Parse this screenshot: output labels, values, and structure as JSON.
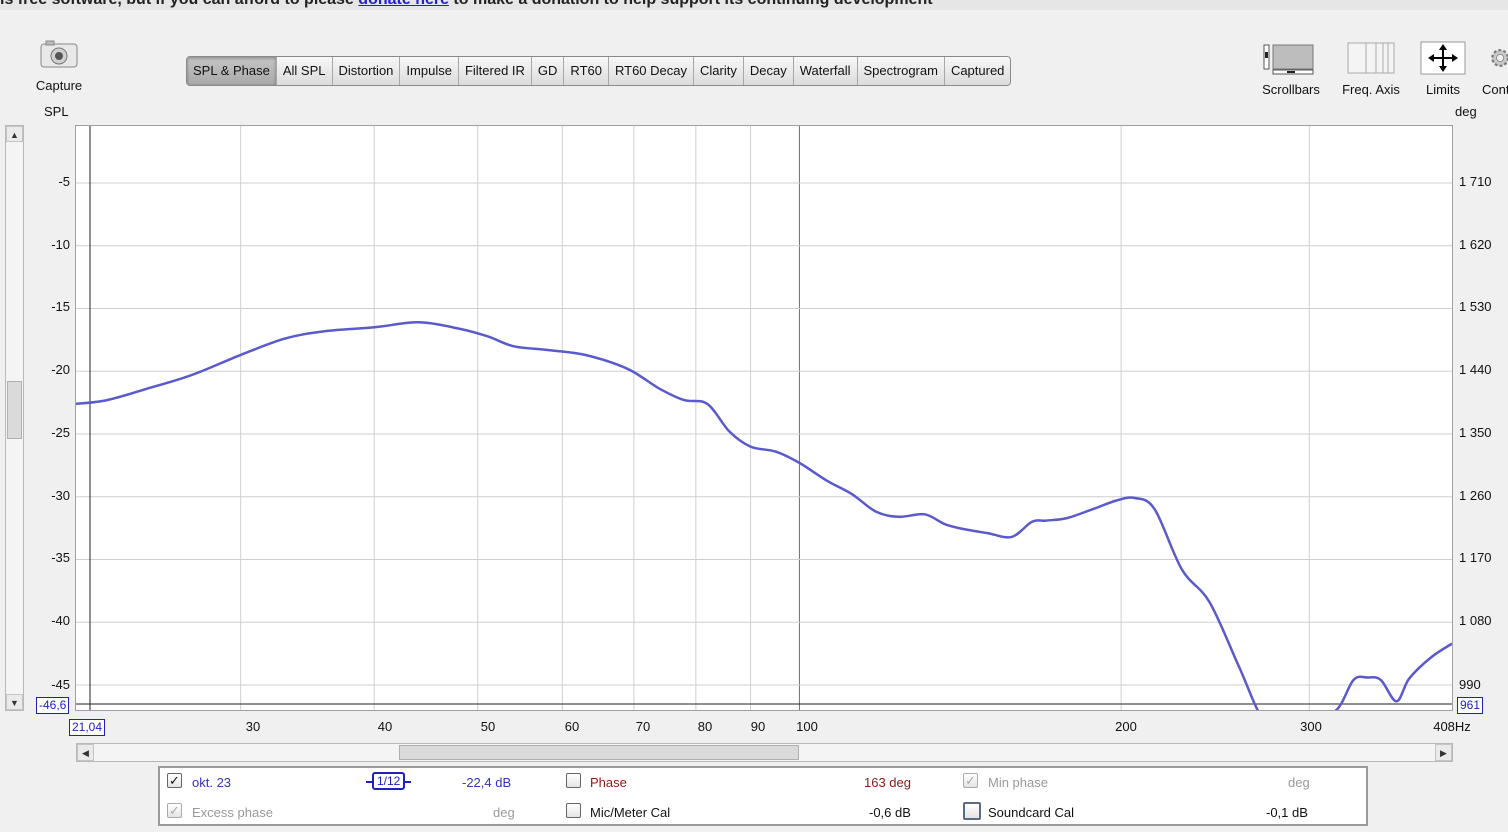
{
  "banner": {
    "text_before": "is free software, but if you can afford to please ",
    "link": "donate here",
    "text_after": " to make a donation to help support its continuing development"
  },
  "capture": {
    "label": "Capture",
    "icon": "camera-icon"
  },
  "tabs": [
    {
      "label": "SPL & Phase",
      "active": true
    },
    {
      "label": "All SPL"
    },
    {
      "label": "Distortion"
    },
    {
      "label": "Impulse"
    },
    {
      "label": "Filtered IR"
    },
    {
      "label": "GD"
    },
    {
      "label": "RT60"
    },
    {
      "label": "RT60 Decay"
    },
    {
      "label": "Clarity"
    },
    {
      "label": "Decay"
    },
    {
      "label": "Waterfall"
    },
    {
      "label": "Spectrogram"
    },
    {
      "label": "Captured"
    }
  ],
  "toolbar": {
    "scrollbars": "Scrollbars",
    "freq_axis": "Freq. Axis",
    "limits": "Limits",
    "controls": "Cont"
  },
  "graph": {
    "left_axis_title": "SPL",
    "right_axis_title": "deg",
    "left_ticks": [
      "-5",
      "-10",
      "-15",
      "-20",
      "-25",
      "-30",
      "-35",
      "-40",
      "-45"
    ],
    "right_ticks": [
      "1 710",
      "1 620",
      "1 530",
      "1 440",
      "1 350",
      "1 260",
      "1 170",
      "1 080",
      "990"
    ],
    "left_bottom_value": "-46,6",
    "right_bottom_value": "961",
    "x_ticks": [
      "30",
      "40",
      "50",
      "60",
      "70",
      "80",
      "90",
      "100",
      "200",
      "300"
    ],
    "x_start_value": "21,04",
    "x_end_label": "408Hz",
    "curve_color": "#5a5acc"
  },
  "chart_data": {
    "type": "line",
    "title": "",
    "xlabel": "Hz",
    "ylabel": "SPL",
    "x_scale": "log",
    "xlim": [
      21.04,
      408
    ],
    "ylim": [
      -46.6,
      0
    ],
    "y2_label": "deg",
    "y2_lim": [
      961,
      1800
    ],
    "grid": true,
    "series": [
      {
        "name": "okt. 23",
        "color": "#5a5acc",
        "x": [
          21.04,
          22.5,
          24.5,
          27,
          30,
          33,
          36,
          40,
          44,
          48,
          51,
          54,
          58,
          63,
          69,
          74,
          78,
          82,
          86,
          90,
          95,
          100,
          106,
          112,
          118,
          124,
          131,
          137,
          143,
          150,
          158,
          165,
          170,
          178,
          188,
          198,
          206,
          215,
          228,
          242,
          258,
          272,
          285,
          300,
          318,
          330,
          340,
          350,
          362,
          372,
          390,
          408
        ],
        "y": [
          -22.6,
          -22.3,
          -21.4,
          -20.3,
          -18.7,
          -17.4,
          -16.8,
          -16.5,
          -16.1,
          -16.6,
          -17.2,
          -18.0,
          -18.3,
          -18.7,
          -19.8,
          -21.4,
          -22.3,
          -22.6,
          -24.8,
          -26.0,
          -26.4,
          -27.3,
          -28.7,
          -29.8,
          -31.2,
          -31.6,
          -31.4,
          -32.2,
          -32.6,
          -32.9,
          -33.2,
          -32.0,
          -31.9,
          -31.7,
          -31.0,
          -30.3,
          -30.1,
          -31.0,
          -35.8,
          -38.4,
          -43.6,
          -48.0,
          -50.0,
          -50.0,
          -47.0,
          -44.6,
          -44.4,
          -44.6,
          -46.3,
          -44.5,
          -42.8,
          -41.7
        ]
      }
    ]
  },
  "legend": {
    "row1": {
      "trace_checked": true,
      "trace_name": "okt. 23",
      "smoothing": "1/12",
      "spl_value": "-22,4 dB",
      "phase_checked": false,
      "phase_label": "Phase",
      "phase_value": "163 deg",
      "minphase_checked": true,
      "minphase_label": "Min phase",
      "minphase_unit": "deg"
    },
    "row2": {
      "excess_checked": true,
      "excess_label": "Excess phase",
      "excess_unit": "deg",
      "micmeter_checked": false,
      "micmeter_label": "Mic/Meter Cal",
      "micmeter_value": "-0,6 dB",
      "soundcard_checked": false,
      "soundcard_label": "Soundcard Cal",
      "soundcard_value": "-0,1 dB"
    }
  }
}
